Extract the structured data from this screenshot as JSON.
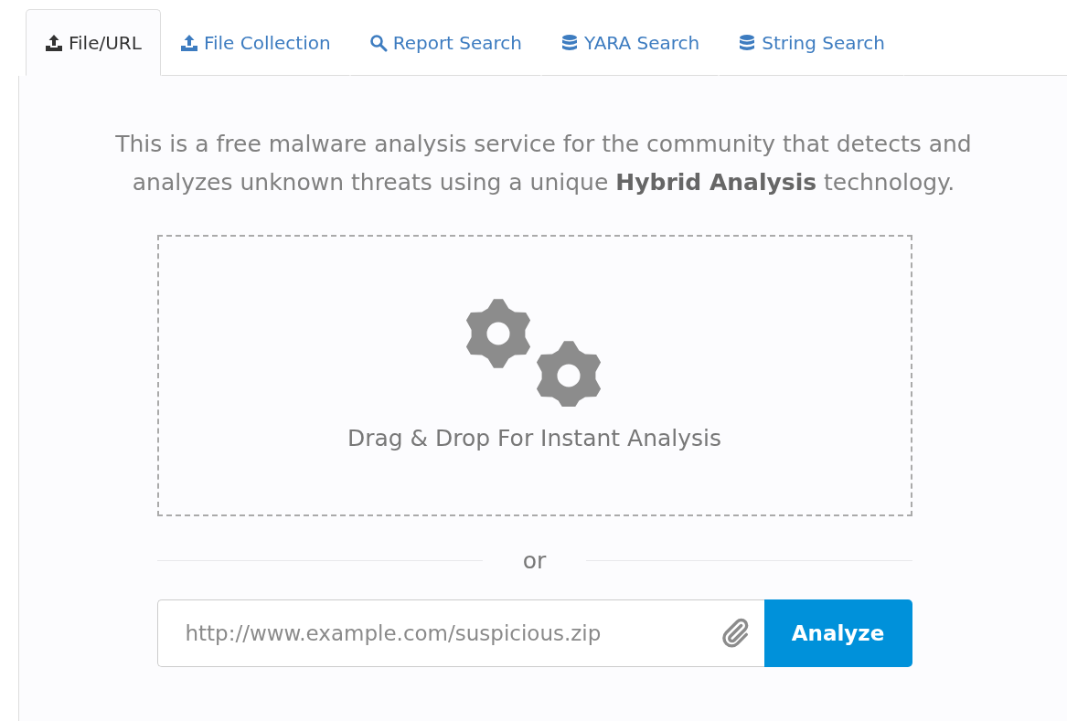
{
  "tabs": [
    {
      "label": "File/URL",
      "kind": "upload",
      "selected": true
    },
    {
      "label": "File Collection",
      "kind": "upload",
      "selected": false
    },
    {
      "label": "Report Search",
      "kind": "search",
      "selected": false
    },
    {
      "label": "YARA Search",
      "kind": "database",
      "selected": false
    },
    {
      "label": "String Search",
      "kind": "database",
      "selected": false
    }
  ],
  "intro": "This is a free malware analysis service for the community that detects and analyzes unknown threats using a unique **Hybrid Analysis** technology.",
  "drop_zone": {
    "label": "Drag & Drop For Instant Analysis"
  },
  "separator": "or",
  "url_field": {
    "placeholder": "http://www.example.com/suspicious.zip"
  },
  "submit_button": "Analyze"
}
